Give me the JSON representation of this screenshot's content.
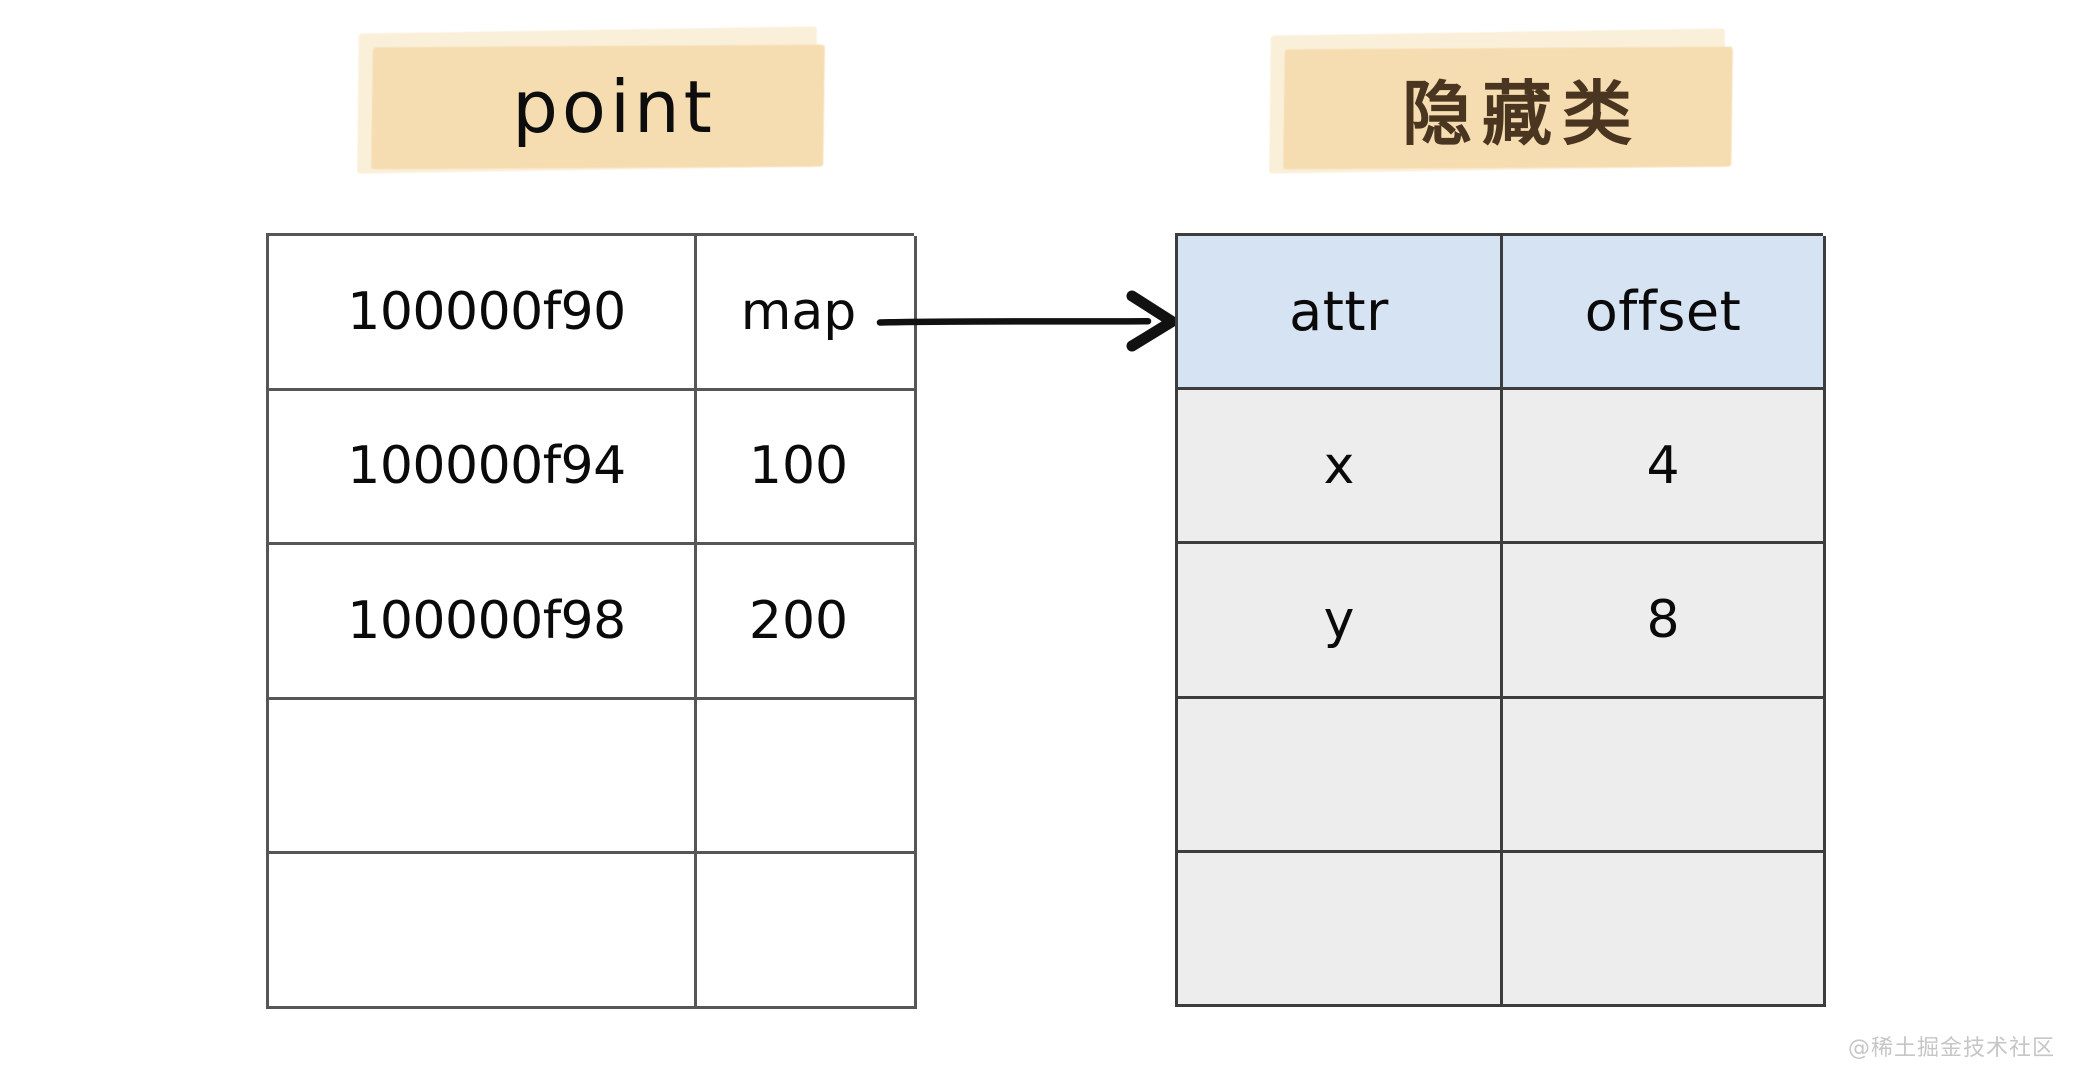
{
  "labels": {
    "left": {
      "text": "point",
      "highlight_color": "#f7dfb0"
    },
    "right": {
      "text": "隐藏类",
      "highlight_color": "#f7dfb0",
      "text_color": "#4a3520"
    }
  },
  "memory_table": {
    "name": "point",
    "rows": [
      {
        "address": "100000f90",
        "value": "map"
      },
      {
        "address": "100000f94",
        "value": "100"
      },
      {
        "address": "100000f98",
        "value": "200"
      },
      {
        "address": "",
        "value": ""
      },
      {
        "address": "",
        "value": ""
      }
    ],
    "border_color": "#565656",
    "cell_bg": "#ffffff"
  },
  "hidden_class_table": {
    "name": "隐藏类",
    "headers": [
      "attr",
      "offset"
    ],
    "rows": [
      {
        "attr": "x",
        "offset": "4"
      },
      {
        "attr": "y",
        "offset": "8"
      },
      {
        "attr": "",
        "offset": ""
      },
      {
        "attr": "",
        "offset": ""
      }
    ],
    "header_bg": "#d6e3f2",
    "cell_bg": "#ededed",
    "border_color": "#3d3d3d"
  },
  "arrow": {
    "from": "map",
    "to": "attr",
    "color": "#111111"
  },
  "watermark": {
    "text": "@稀土掘金技术社区"
  }
}
